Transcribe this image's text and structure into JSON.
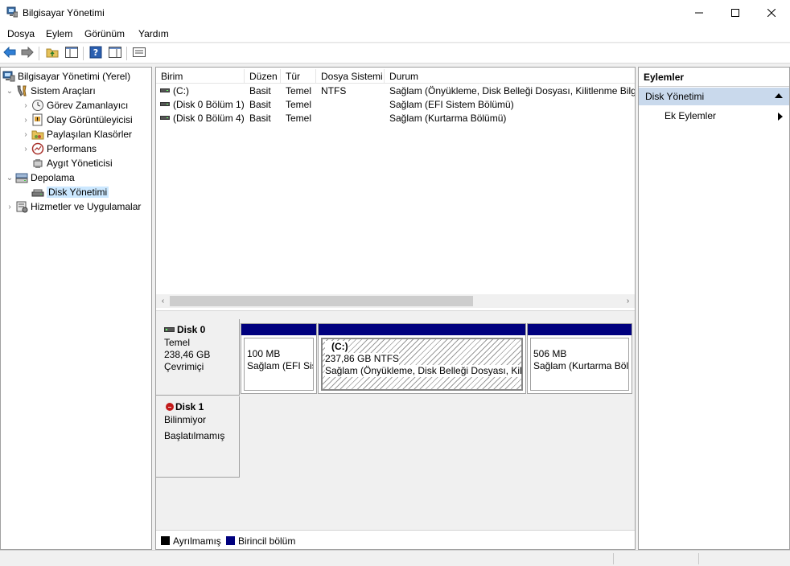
{
  "window": {
    "title": "Bilgisayar Yönetimi"
  },
  "menu": [
    {
      "label": "Dosya"
    },
    {
      "label": "Eylem"
    },
    {
      "label": "Görünüm"
    },
    {
      "label": "Yardım"
    }
  ],
  "toolbar": {
    "buttons": [
      "back-arrow-icon",
      "forward-arrow-icon",
      "up-folder-icon",
      "show-hide-tree-icon",
      "help-icon",
      "action-pane-icon",
      "properties-icon"
    ]
  },
  "tree": {
    "items": [
      {
        "label": "Bilgisayar Yönetimi (Yerel)",
        "icon": "computer-icon",
        "level": 0,
        "expander": ""
      },
      {
        "label": "Sistem Araçları",
        "icon": "tools-icon",
        "level": 0,
        "expander": "expanded"
      },
      {
        "label": "Görev Zamanlayıcı",
        "icon": "clock-icon",
        "level": 1,
        "expander": "collapsed"
      },
      {
        "label": "Olay Görüntüleyicisi",
        "icon": "event-viewer-icon",
        "level": 1,
        "expander": "collapsed"
      },
      {
        "label": "Paylaşılan Klasörler",
        "icon": "shared-folder-icon",
        "level": 1,
        "expander": "collapsed"
      },
      {
        "label": "Performans",
        "icon": "performance-icon",
        "level": 1,
        "expander": "collapsed"
      },
      {
        "label": "Aygıt Yöneticisi",
        "icon": "device-manager-icon",
        "level": 1,
        "expander": ""
      },
      {
        "label": "Depolama",
        "icon": "storage-icon",
        "level": 0,
        "expander": "expanded"
      },
      {
        "label": "Disk Yönetimi",
        "icon": "disk-management-icon",
        "level": 1,
        "expander": "",
        "selected": true
      },
      {
        "label": "Hizmetler ve Uygulamalar",
        "icon": "services-icon",
        "level": 0,
        "expander": "collapsed"
      }
    ]
  },
  "volumes": {
    "columns": [
      "Birim",
      "Düzen",
      "Tür",
      "Dosya Sistemi",
      "Durum"
    ],
    "rows": [
      {
        "birim": "(C:)",
        "duzen": "Basit",
        "tur": "Temel",
        "fs": "NTFS",
        "durum": "Sağlam (Önyükleme, Disk Belleği Dosyası, Kilitlenme Bilgisi"
      },
      {
        "birim": "(Disk 0 Bölüm 1)",
        "duzen": "Basit",
        "tur": "Temel",
        "fs": "",
        "durum": "Sağlam (EFI Sistem Bölümü)"
      },
      {
        "birim": "(Disk 0 Bölüm 4)",
        "duzen": "Basit",
        "tur": "Temel",
        "fs": "",
        "durum": "Sağlam (Kurtarma Bölümü)"
      }
    ]
  },
  "disks": [
    {
      "name": "Disk 0",
      "type": "Temel",
      "size": "238,46 GB",
      "status": "Çevrimiçi",
      "partitions": [
        {
          "title": "",
          "size": "100 MB",
          "status": "Sağlam (EFI Sistem Bölümü)"
        },
        {
          "title": "(C:)",
          "size": "237,86 GB NTFS",
          "status": "Sağlam (Önyükleme, Disk Belleği Dosyası, Kilitlenme Bilgisi",
          "selected": true
        },
        {
          "title": "",
          "size": "506 MB",
          "status": "Sağlam (Kurtarma Bölümü)"
        }
      ]
    },
    {
      "name": "Disk 1",
      "type": "Bilinmiyor",
      "size": "",
      "status": "Başlatılmamış"
    }
  ],
  "legend": [
    {
      "label": "Ayrılmamış",
      "color": "#000000"
    },
    {
      "label": "Birincil bölüm",
      "color": "#00007e"
    }
  ],
  "actions": {
    "header": "Eylemler",
    "section": "Disk Yönetimi",
    "item": "Ek Eylemler"
  }
}
